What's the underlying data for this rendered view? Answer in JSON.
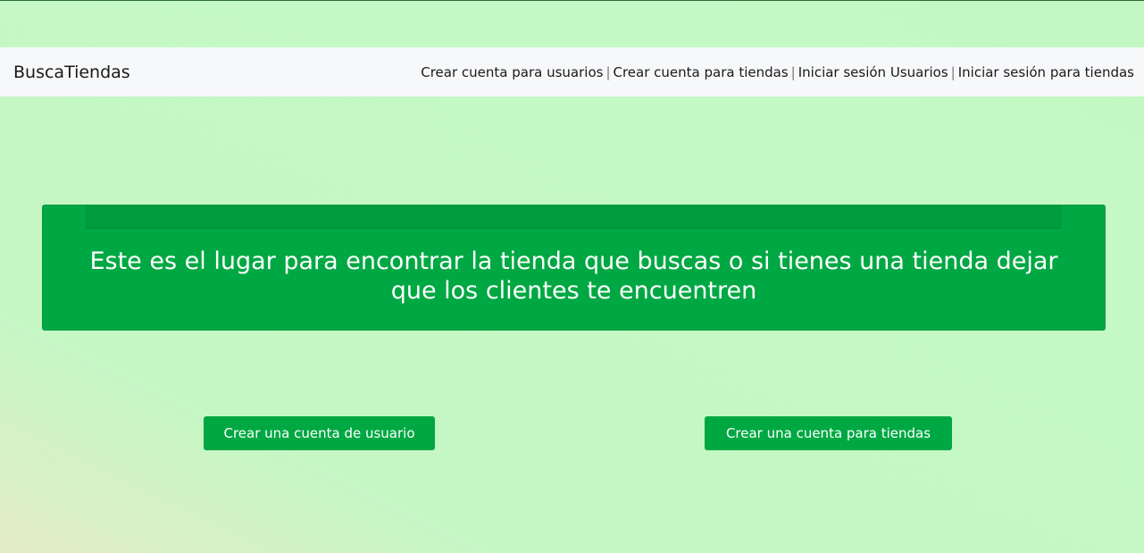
{
  "navbar": {
    "brand": "BuscaTiendas",
    "links": [
      {
        "label": "Crear cuenta para usuarios"
      },
      {
        "label": "Crear cuenta para tiendas"
      },
      {
        "label": "Iniciar sesión Usuarios"
      },
      {
        "label": "Iniciar sesión para tiendas"
      }
    ],
    "separator": "|"
  },
  "hero": {
    "text": "Este es el lugar para encontrar la tienda que buscas o si tienes una tienda dejar que los clientes te encuentren"
  },
  "actions": {
    "user_button_label": "Crear una cuenta de usuario",
    "store_button_label": "Crear una cuenta para tiendas"
  },
  "colors": {
    "page_background": "#c3f8c3",
    "navbar_background": "#f7f8fa",
    "accent_green": "#00a843"
  }
}
